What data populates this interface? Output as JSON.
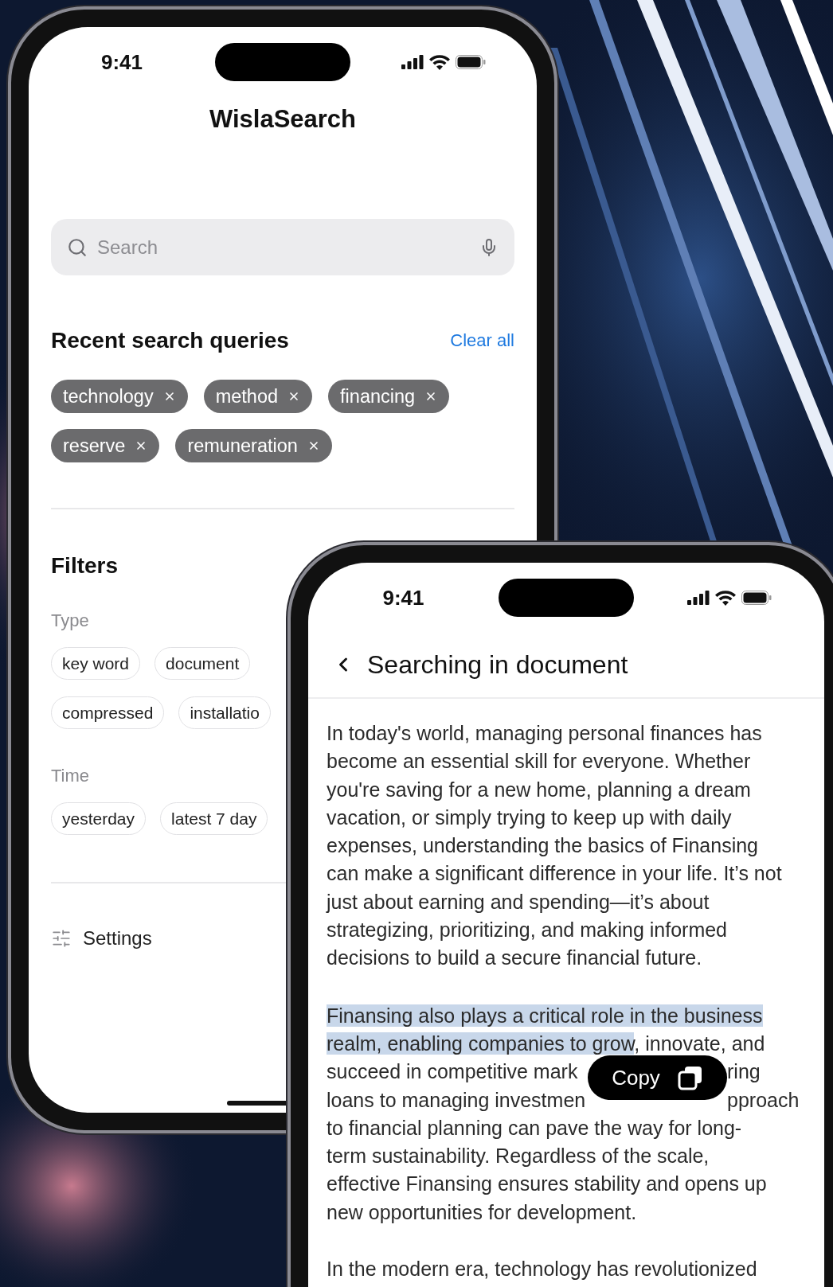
{
  "search_app": {
    "status_bar": {
      "time": "9:41"
    },
    "title": "WislaSearch",
    "search": {
      "placeholder": "Search"
    },
    "recent": {
      "heading": "Recent search queries",
      "action": "Clear all",
      "queries": [
        {
          "label": "technology"
        },
        {
          "label": "method"
        },
        {
          "label": "financing"
        },
        {
          "label": "reserve"
        },
        {
          "label": "remuneration"
        }
      ]
    },
    "filters": {
      "heading": "Filters",
      "groups": [
        {
          "label": "Type",
          "rows": [
            [
              "key word",
              "document"
            ],
            [
              "compressed",
              "installatio"
            ]
          ]
        },
        {
          "label": "Time",
          "rows": [
            [
              "yesterday",
              "latest 7 day"
            ]
          ]
        }
      ]
    },
    "settings": {
      "label": "Settings"
    }
  },
  "document_view": {
    "status_bar": {
      "time": "9:41"
    },
    "title": "Searching in document",
    "paragraphs": [
      {
        "kind": "plain",
        "text": "In today's world, managing personal finances has\nbecome an essential skill for everyone. Whether\nyou're saving for a new home, planning a dream\nvacation, or simply trying to keep up with daily\nexpenses, understanding the basics of Finansing\ncan make a significant difference in your life. It’s not\njust about earning and spending—it’s about\nstrategizing, prioritizing, and making informed\ndecisions to build a secure financial future."
      },
      {
        "kind": "lines",
        "lines": [
          {
            "kind": "text",
            "segments": [
              {
                "text": "Finansing also plays a critical role in the business",
                "selected": true
              }
            ]
          },
          {
            "kind": "text",
            "segments": [
              {
                "text": "realm, enabling companies to grow",
                "selected": true
              },
              {
                "text": ", innovate, and",
                "selected": false
              }
            ]
          },
          {
            "kind": "split",
            "left": "succeed in competitive mark",
            "right": "ring"
          },
          {
            "kind": "split",
            "left": "loans to managing investmen",
            "right": "pproach"
          },
          {
            "kind": "text",
            "segments": [
              {
                "text": "to financial planning can pave the way for long-",
                "selected": false
              }
            ]
          },
          {
            "kind": "text",
            "segments": [
              {
                "text": "term sustainability. Regardless of the scale,",
                "selected": false
              }
            ]
          },
          {
            "kind": "text",
            "segments": [
              {
                "text": "effective Finansing ensures stability and opens up",
                "selected": false
              }
            ]
          },
          {
            "kind": "text",
            "segments": [
              {
                "text": "new opportunities for development.",
                "selected": false
              }
            ]
          }
        ]
      },
      {
        "kind": "plain",
        "text": "In the modern era, technology has revolutionized"
      }
    ],
    "popup": {
      "label": "Copy"
    }
  }
}
